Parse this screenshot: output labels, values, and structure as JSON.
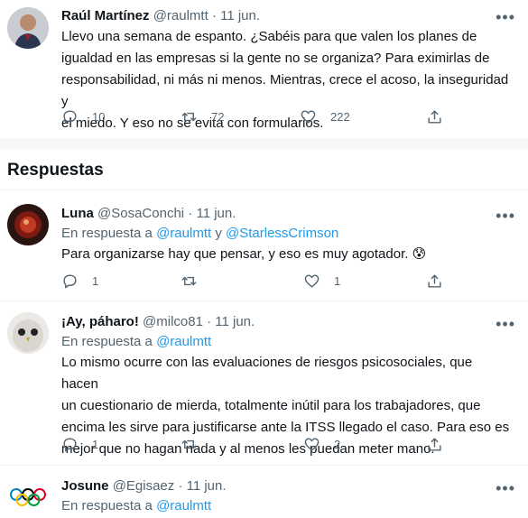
{
  "main_tweet": {
    "name": "Raúl Martínez",
    "handle": "@raulmtt",
    "date": "· 11 jun.",
    "lines": [
      "Llevo una semana de espanto. ¿Sabéis para que valen los planes de",
      "igualdad en las empresas si la gente no se organiza? Para eximirlas de",
      "responsabilidad, ni más ni menos. Mientras, crece el acoso, la inseguridad y",
      "el miedo. Y eso no se evita con formularios."
    ],
    "replies": "10",
    "retweets": "72",
    "likes": "222"
  },
  "section": {
    "title": "Respuestas"
  },
  "reply1": {
    "name": "Luna",
    "handle": "@SosaConchi",
    "date": "· 11 jun.",
    "in_reply_prefix": "En respuesta a ",
    "mention1": "@raulmtt",
    "joiner": " y ",
    "mention2": "@StarlessCrimson",
    "text": "Para organizarse hay que pensar, y eso es muy agotador. 😰",
    "replies": "1",
    "likes": "1"
  },
  "reply2": {
    "name": "¡Ay, páharo!",
    "handle": "@milco81",
    "date": "· 11 jun.",
    "in_reply_prefix": "En respuesta a ",
    "mention1": "@raulmtt",
    "lines": [
      "Lo mismo ocurre con las evaluaciones de riesgos psicosociales, que hacen",
      "un cuestionario de mierda, totalmente inútil para los trabajadores, que",
      "encima les sirve para justificarse ante la ITSS llegado el caso. Para eso es",
      "mejor que no hagan nada y al menos les puedan meter mano."
    ],
    "replies": "1",
    "likes": "2"
  },
  "reply3": {
    "name": "Josune",
    "handle": "@Egisaez",
    "date": "· 11 jun.",
    "in_reply_prefix": "En respuesta a ",
    "mention1": "@raulmtt"
  },
  "icons": [
    "reply-icon",
    "retweet-icon",
    "like-icon",
    "share-icon",
    "more-icon"
  ]
}
